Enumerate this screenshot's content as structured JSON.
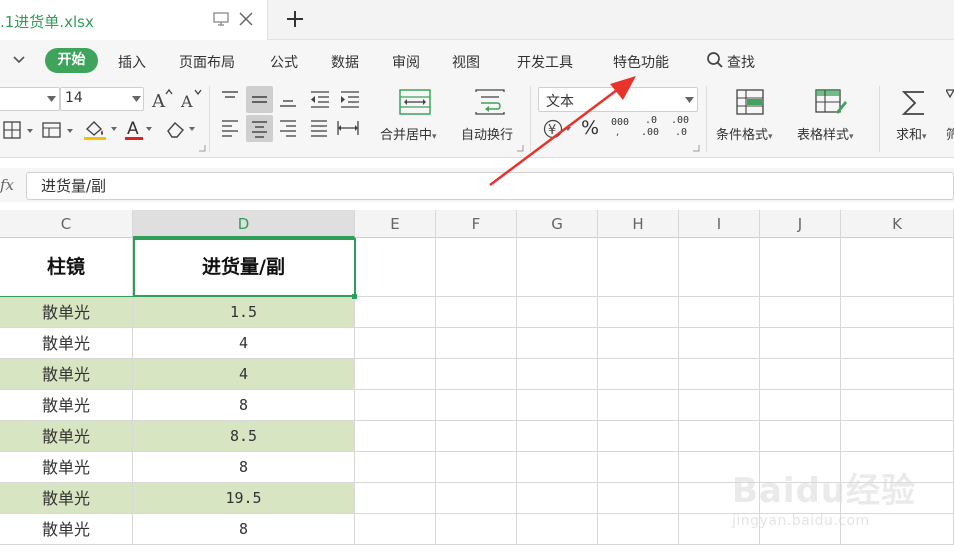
{
  "tabbar": {
    "doc_title": ".1进货单.xlsx",
    "monitor_icon": "monitor-icon",
    "close_icon": "close-icon",
    "new_tab_icon": "plus-icon"
  },
  "menubar": {
    "collapse_icon": "chevron-down-icon",
    "active": "开始",
    "items": [
      "插入",
      "页面布局",
      "公式",
      "数据",
      "审阅",
      "视图",
      "开发工具",
      "特色功能"
    ],
    "search_label": "查找",
    "search_icon": "search-icon"
  },
  "ribbon": {
    "font_size": "14",
    "number_format": "文本",
    "merge_label": "合并居中",
    "wrap_label": "自动换行",
    "cond_format_label": "条件格式",
    "table_style_label": "表格样式",
    "sum_label": "求和",
    "currency_symbol": "¥",
    "percent_symbol": "%",
    "thousands_symbol": "000",
    "inc_decimal": ".00",
    "dec_decimal": ".0",
    "colors": {
      "font_color": "#e02020",
      "fill_color": "#f2c200",
      "accent": "#3ea35b"
    }
  },
  "formula_bar": {
    "fx_label": "fx",
    "value": "进货量/副"
  },
  "grid": {
    "columns": [
      "C",
      "D",
      "E",
      "F",
      "G",
      "H",
      "I",
      "J",
      "K"
    ],
    "selected_column": "D",
    "header_row": {
      "c": "柱镜",
      "d": "进货量/副"
    },
    "rows": [
      {
        "c": "散单光",
        "d": "1.5"
      },
      {
        "c": "散单光",
        "d": "4"
      },
      {
        "c": "散单光",
        "d": "4"
      },
      {
        "c": "散单光",
        "d": "8"
      },
      {
        "c": "散单光",
        "d": "8.5"
      },
      {
        "c": "散单光",
        "d": "8"
      },
      {
        "c": "散单光",
        "d": "19.5"
      },
      {
        "c": "散单光",
        "d": "8"
      }
    ],
    "band_color": "#d8e5c2"
  },
  "watermark": {
    "brand": "Baidu经验",
    "url": "jingyan.baidu.com"
  }
}
